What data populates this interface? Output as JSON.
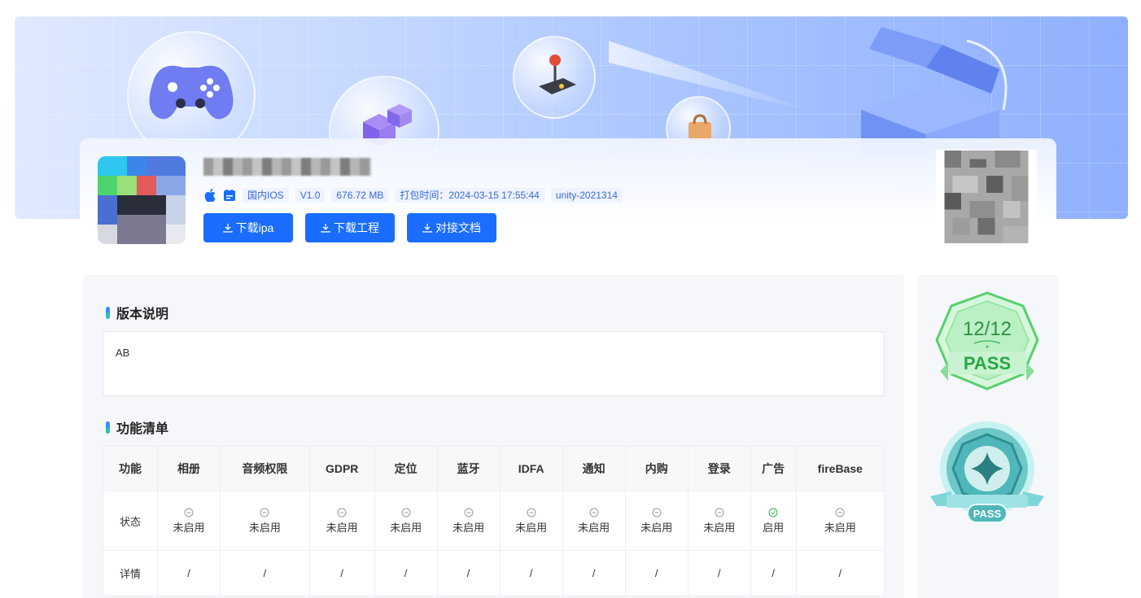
{
  "app": {
    "name_hidden": "",
    "platform": "国内IOS",
    "version": "V1.0",
    "size": "676.72 MB",
    "build_time": "打包时间：2024-03-15 17:55:44",
    "engine": "unity-2021314"
  },
  "buttons": {
    "download_ipa": "下载ipa",
    "download_project": "下载工程",
    "docs": "对接文档"
  },
  "sections": {
    "version_notes_title": "版本说明",
    "version_notes_text": "AB",
    "features_title": "功能清单"
  },
  "table": {
    "row_header_feature": "功能",
    "row_header_status": "状态",
    "row_header_detail": "详情",
    "columns": [
      {
        "name": "相册",
        "status": "未启用",
        "enabled": false,
        "detail": "/"
      },
      {
        "name": "音频权限",
        "status": "未启用",
        "enabled": false,
        "detail": "/"
      },
      {
        "name": "GDPR",
        "status": "未启用",
        "enabled": false,
        "detail": "/"
      },
      {
        "name": "定位",
        "status": "未启用",
        "enabled": false,
        "detail": "/"
      },
      {
        "name": "蓝牙",
        "status": "未启用",
        "enabled": false,
        "detail": "/"
      },
      {
        "name": "IDFA",
        "status": "未启用",
        "enabled": false,
        "detail": "/"
      },
      {
        "name": "通知",
        "status": "未启用",
        "enabled": false,
        "detail": "/"
      },
      {
        "name": "内购",
        "status": "未启用",
        "enabled": false,
        "detail": "/"
      },
      {
        "name": "登录",
        "status": "未启用",
        "enabled": false,
        "detail": "/"
      },
      {
        "name": "广告",
        "status": "启用",
        "enabled": true,
        "detail": "/"
      },
      {
        "name": "fireBase",
        "status": "未启用",
        "enabled": false,
        "detail": "/"
      }
    ]
  },
  "badges": {
    "check_count": "12/12",
    "check_label": "PASS",
    "review_label": "PASS"
  },
  "colors": {
    "primary": "#1a6dff",
    "enabled": "#2fb34a",
    "disabled": "#999999",
    "badge_green": "#3fc85a",
    "badge_teal": "#4fb7b9"
  }
}
